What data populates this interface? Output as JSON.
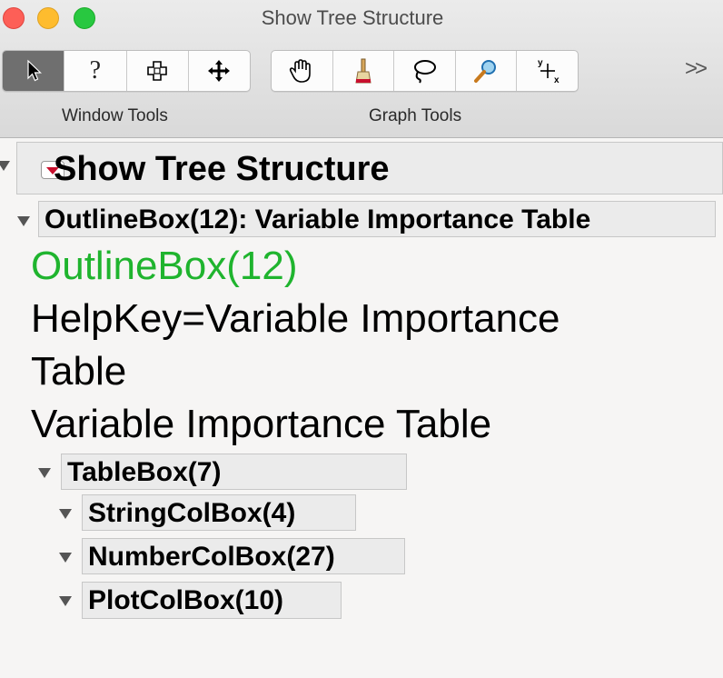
{
  "window": {
    "title": "Show Tree Structure"
  },
  "toolbar": {
    "window_tools_label": "Window Tools",
    "graph_tools_label": "Graph Tools",
    "overflow_label": ">>",
    "window_tools": [
      {
        "name": "arrow-tool",
        "icon": "arrow-cursor-icon",
        "glyph": "↖",
        "selected": true
      },
      {
        "name": "help-tool",
        "icon": "question-icon",
        "glyph": "?"
      },
      {
        "name": "selection-tool",
        "icon": "selection-cross-icon",
        "glyph": "✛"
      },
      {
        "name": "move-tool",
        "icon": "move-arrows-icon",
        "glyph": "✥"
      }
    ],
    "graph_tools": [
      {
        "name": "grabber-tool",
        "icon": "hand-icon",
        "glyph": "✋"
      },
      {
        "name": "brush-tool",
        "icon": "brush-icon",
        "glyph": "✎"
      },
      {
        "name": "lasso-tool",
        "icon": "lasso-icon",
        "glyph": "➰"
      },
      {
        "name": "magnifier-tool",
        "icon": "magnifier-icon",
        "glyph": "⌕"
      },
      {
        "name": "crosshair-tool",
        "icon": "crosshair-xy-icon",
        "glyph": "✚"
      }
    ]
  },
  "tree": {
    "root_title": "Show Tree Structure",
    "outline_header": "OutlineBox(12): Variable Importance Table",
    "props": {
      "box_id": "OutlineBox(12)",
      "helpkey_line1": "HelpKey=Variable Importance",
      "helpkey_line2": "Table",
      "title": "Variable Importance Table"
    },
    "tablebox": "TableBox(7)",
    "children": [
      "StringColBox(4)",
      "NumberColBox(27)",
      "PlotColBox(10)"
    ]
  },
  "colors": {
    "accent_red": "#c8102e",
    "id_green": "#1fb42e"
  }
}
